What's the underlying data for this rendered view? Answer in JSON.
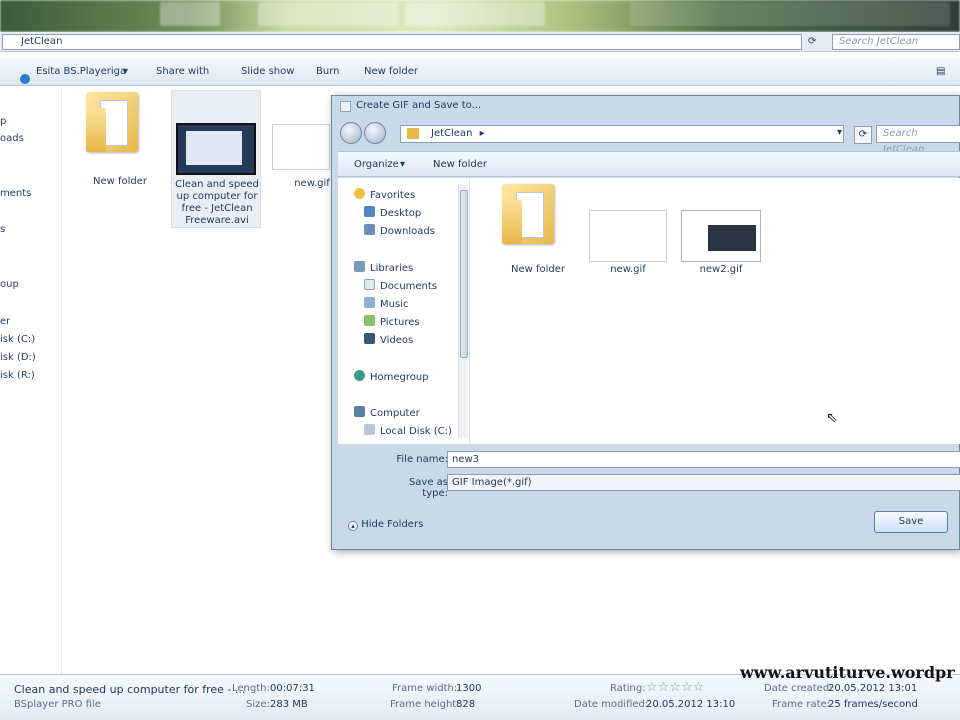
{
  "explorer": {
    "breadcrumb": "JetClean",
    "search_placeholder": "Search JetClean",
    "toolbar": {
      "play": "Esita BS.Playeriga",
      "share": "Share with",
      "slideshow": "Slide show",
      "burn": "Burn",
      "new_folder": "New folder"
    },
    "nav_fragments": [
      "p",
      "oads",
      "ments",
      "s",
      "oup",
      "er",
      "isk (C:)",
      "isk (D:)",
      "isk (R:)"
    ],
    "files": [
      {
        "label": "New folder"
      },
      {
        "label": "Clean and speed up computer for free - JetClean Freeware.avi"
      },
      {
        "label": "new.gif"
      }
    ]
  },
  "dialog": {
    "title": "Create GIF and Save to...",
    "path": "JetClean",
    "search_placeholder": "Search JetClean",
    "organize": "Organize",
    "new_folder": "New folder",
    "nav": {
      "favorites": "Favorites",
      "desktop": "Desktop",
      "downloads": "Downloads",
      "libraries": "Libraries",
      "documents": "Documents",
      "music": "Music",
      "pictures": "Pictures",
      "videos": "Videos",
      "homegroup": "Homegroup",
      "computer": "Computer",
      "local_disk": "Local Disk (C:)"
    },
    "files": [
      {
        "label": "New folder"
      },
      {
        "label": "new.gif"
      },
      {
        "label": "new2.gif"
      }
    ],
    "file_name_label": "File name:",
    "file_name_value": "new3",
    "save_as_type_label": "Save as type:",
    "save_as_type_value": "GIF Image(*.gif)",
    "hide_folders": "Hide Folders",
    "save_button": "Save"
  },
  "details": {
    "name": "Clean and speed up computer for free - ...",
    "type": "BSplayer PRO file",
    "length_label": "Length:",
    "length_value": "00:07:31",
    "size_label": "Size:",
    "size_value": "283 MB",
    "frame_width_label": "Frame width:",
    "frame_width_value": "1300",
    "frame_height_label": "Frame height:",
    "frame_height_value": "828",
    "rating_label": "Rating:",
    "rating_stars": "☆☆☆☆☆",
    "date_modified_label": "Date modified:",
    "date_modified_value": "20.05.2012 13:10",
    "date_created_label": "Date created:",
    "date_created_value": "20.05.2012 13:01",
    "frame_rate_label": "Frame rate:",
    "frame_rate_value": "25 frames/second"
  },
  "watermark": "www.arvutiturve.wordpr",
  "colors": {
    "accent": "#1e395b",
    "dialog_frame": "#cad9ea"
  }
}
